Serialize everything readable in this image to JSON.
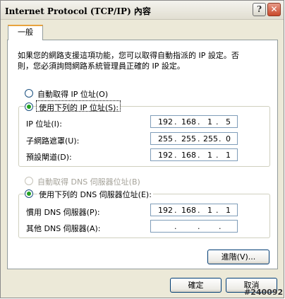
{
  "window": {
    "title": "Internet Protocol (TCP/IP) 內容",
    "help_glyph": "?",
    "close_glyph": "✕"
  },
  "tab": {
    "label": "一般"
  },
  "description": {
    "line1": "如果您的網路支援這項功能，您可以取得自動指派的 IP 設定。否",
    "line2": "則，您必須詢問網路系統管理員正確的 IP 設定。"
  },
  "ip_mode": {
    "auto_label": "自動取得 IP 位址(O)",
    "manual_label": "使用下列的 IP 位址(S):",
    "selected": "manual"
  },
  "ip_fields": {
    "ip_label": "IP 位址(I):",
    "ip": [
      "192",
      "168",
      "1",
      "5"
    ],
    "mask_label": "子網路遮罩(U):",
    "mask": [
      "255",
      "255",
      "255",
      "0"
    ],
    "gateway_label": "預設閘道(D):",
    "gateway": [
      "192",
      "168",
      "1",
      "1"
    ]
  },
  "dns_mode": {
    "auto_label": "自動取得 DNS 伺服器位址(B)",
    "manual_label": "使用下列的 DNS 伺服器位址(E):",
    "selected": "manual"
  },
  "dns_fields": {
    "preferred_label": "慣用 DNS 伺服器(P):",
    "preferred": [
      "192",
      "168",
      "1",
      "1"
    ],
    "alternate_label": "其他 DNS 伺服器(A):",
    "alternate": [
      "",
      "",
      "",
      ""
    ],
    "dot": "."
  },
  "buttons": {
    "advanced": "進階(V)...",
    "ok": "確定",
    "cancel": "取消"
  },
  "watermark": "#240092"
}
